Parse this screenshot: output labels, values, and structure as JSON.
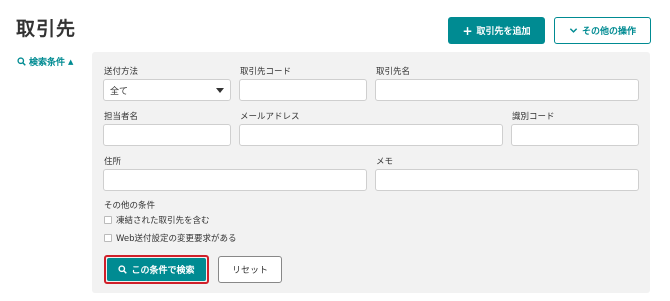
{
  "header": {
    "title": "取引先",
    "add_button_label": "取引先を追加",
    "other_ops_label": "その他の操作"
  },
  "search_toggle": {
    "label": "検索条件"
  },
  "form": {
    "send_method": {
      "label": "送付方法",
      "value": "全て"
    },
    "partner_code": {
      "label": "取引先コード",
      "value": ""
    },
    "partner_name": {
      "label": "取引先名",
      "value": ""
    },
    "contact_name": {
      "label": "担当者名",
      "value": ""
    },
    "email": {
      "label": "メールアドレス",
      "value": ""
    },
    "id_code": {
      "label": "識別コード",
      "value": ""
    },
    "address": {
      "label": "住所",
      "value": ""
    },
    "memo": {
      "label": "メモ",
      "value": ""
    },
    "other_conditions": {
      "label": "その他の条件",
      "options": [
        {
          "label": "凍結された取引先を含む",
          "checked": false
        },
        {
          "label": "Web送付設定の変更要求がある",
          "checked": false
        }
      ]
    },
    "search_button_label": "この条件で検索",
    "reset_button_label": "リセット"
  },
  "colors": {
    "accent": "#008b92",
    "highlight": "#d0202a"
  }
}
